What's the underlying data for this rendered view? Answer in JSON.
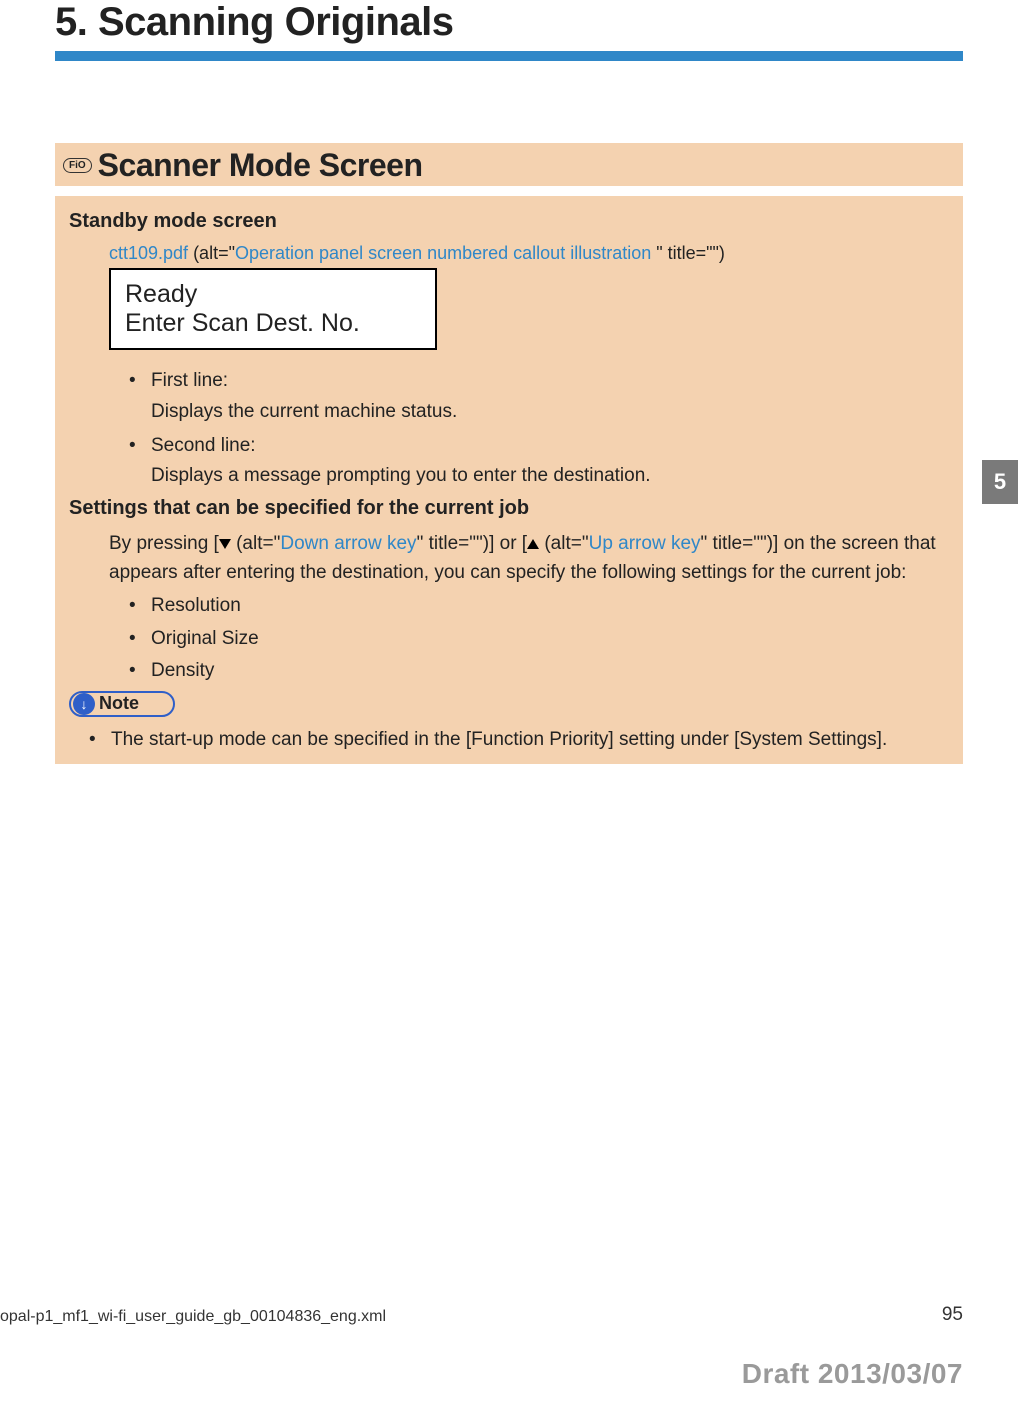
{
  "chapter": {
    "title": "5. Scanning Originals"
  },
  "section": {
    "badge": "FiO",
    "title": "Scanner Mode Screen"
  },
  "standby": {
    "heading": "Standby mode screen",
    "pdf_link": "ctt109.pdf",
    "alt_prefix": " (alt=\"",
    "alt_text": "Operation panel screen numbered callout illustration ",
    "alt_suffix": "\" title=\"\")",
    "lcd_line1": "Ready",
    "lcd_line2": "Enter Scan Dest. No.",
    "items": [
      {
        "label": "First line:",
        "desc": "Displays the current machine status."
      },
      {
        "label": "Second line:",
        "desc": "Displays a message prompting you to enter the destination."
      }
    ]
  },
  "settings": {
    "heading": "Settings that can be specified for the current job",
    "para_pre": "By pressing [",
    "down_alt_pre": " (alt=\"",
    "down_alt": "Down arrow key",
    "down_alt_post": "\" title=\"\")] or [",
    "up_alt_pre": " (alt=\"",
    "up_alt": "Up arrow key",
    "up_alt_post": "\" title=\"\")] on the screen that appears after entering the destination, you can specify the following settings for the current job:",
    "items": [
      "Resolution",
      "Original Size",
      "Density"
    ]
  },
  "note": {
    "label": "Note",
    "items": [
      "The start-up mode can be specified in the [Function Priority] setting under [System Settings]."
    ]
  },
  "sidetab": "5",
  "footer": {
    "left": "opal-p1_mf1_wi-fi_user_guide_gb_00104836_eng.xml",
    "right": "95",
    "draft": "Draft 2013/03/07"
  }
}
